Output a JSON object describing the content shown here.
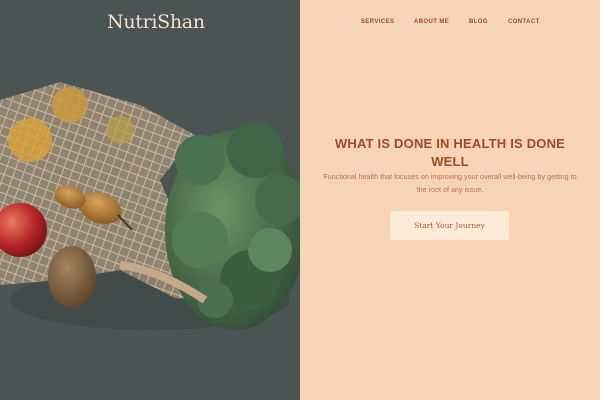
{
  "brand": {
    "logo_text": "NutriShan"
  },
  "nav": {
    "items": [
      {
        "label": "SERVICES"
      },
      {
        "label": "ABOUT ME"
      },
      {
        "label": "BLOG"
      },
      {
        "label": "CONTACT"
      }
    ]
  },
  "hero": {
    "title": "WHAT IS DONE IN HEALTH IS DONE WELL",
    "subtitle": "Functional health that focuses on improving your overall well-being by getting to the root of any issue.",
    "cta_label": "Start Your Journey",
    "image_alt": "Mesh produce bag with apples, pears and a kiwi next to a bunch of kale"
  },
  "colors": {
    "left_bg": "#4a5553",
    "right_bg": "#f8d4b7",
    "accent": "#a04a26",
    "button_bg": "#fcebd9"
  }
}
